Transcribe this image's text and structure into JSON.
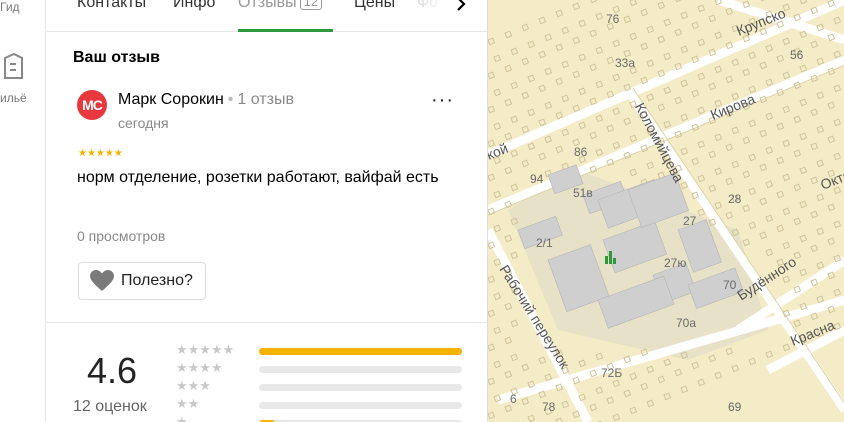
{
  "rail": {
    "top_label": "Гид",
    "bottom_label": "ильё"
  },
  "tabs": [
    {
      "label": "Контакты"
    },
    {
      "label": "Инфо"
    },
    {
      "label": "Отзывы",
      "count": "12",
      "active": true
    },
    {
      "label": "Цены"
    },
    {
      "label": "Фо"
    }
  ],
  "review": {
    "section_title": "Ваш отзыв",
    "avatar_initials": "MC",
    "author": "Марк Сорокин",
    "author_reviews": "1 отзыв",
    "date": "сегодня",
    "rating_stars": "★★★★★",
    "text": "норм отделение, розетки работают, вайфай есть",
    "views": "0 просмотров",
    "helpful_label": "Полезно?"
  },
  "summary": {
    "rating": "4.6",
    "ratings_count": "12 оценок",
    "distribution": [
      {
        "stars": "★★★★★",
        "fraction": 1.0
      },
      {
        "stars": "★★★★",
        "fraction": 0.0
      },
      {
        "stars": "★★★",
        "fraction": 0.0
      },
      {
        "stars": "★★",
        "fraction": 0.0
      },
      {
        "stars": "★",
        "fraction": 0.08
      }
    ]
  },
  "map": {
    "streets": [
      "Крупско",
      "Кирова",
      "Коломийцева",
      "кой",
      "Октя",
      "Будённого",
      "Рабочий переулок",
      "Красна"
    ],
    "house_numbers": [
      "76",
      "33а",
      "56",
      "86",
      "94",
      "51в",
      "28",
      "27",
      "2/1",
      "27ю",
      "70",
      "70а",
      "72Б",
      "6",
      "78",
      "69"
    ],
    "colors": {
      "land": "#f4ebc7",
      "road": "#ffffff",
      "building": "#c9c9c9",
      "industrial": "#e7e1c7",
      "poi": "#2c9a3a"
    }
  }
}
